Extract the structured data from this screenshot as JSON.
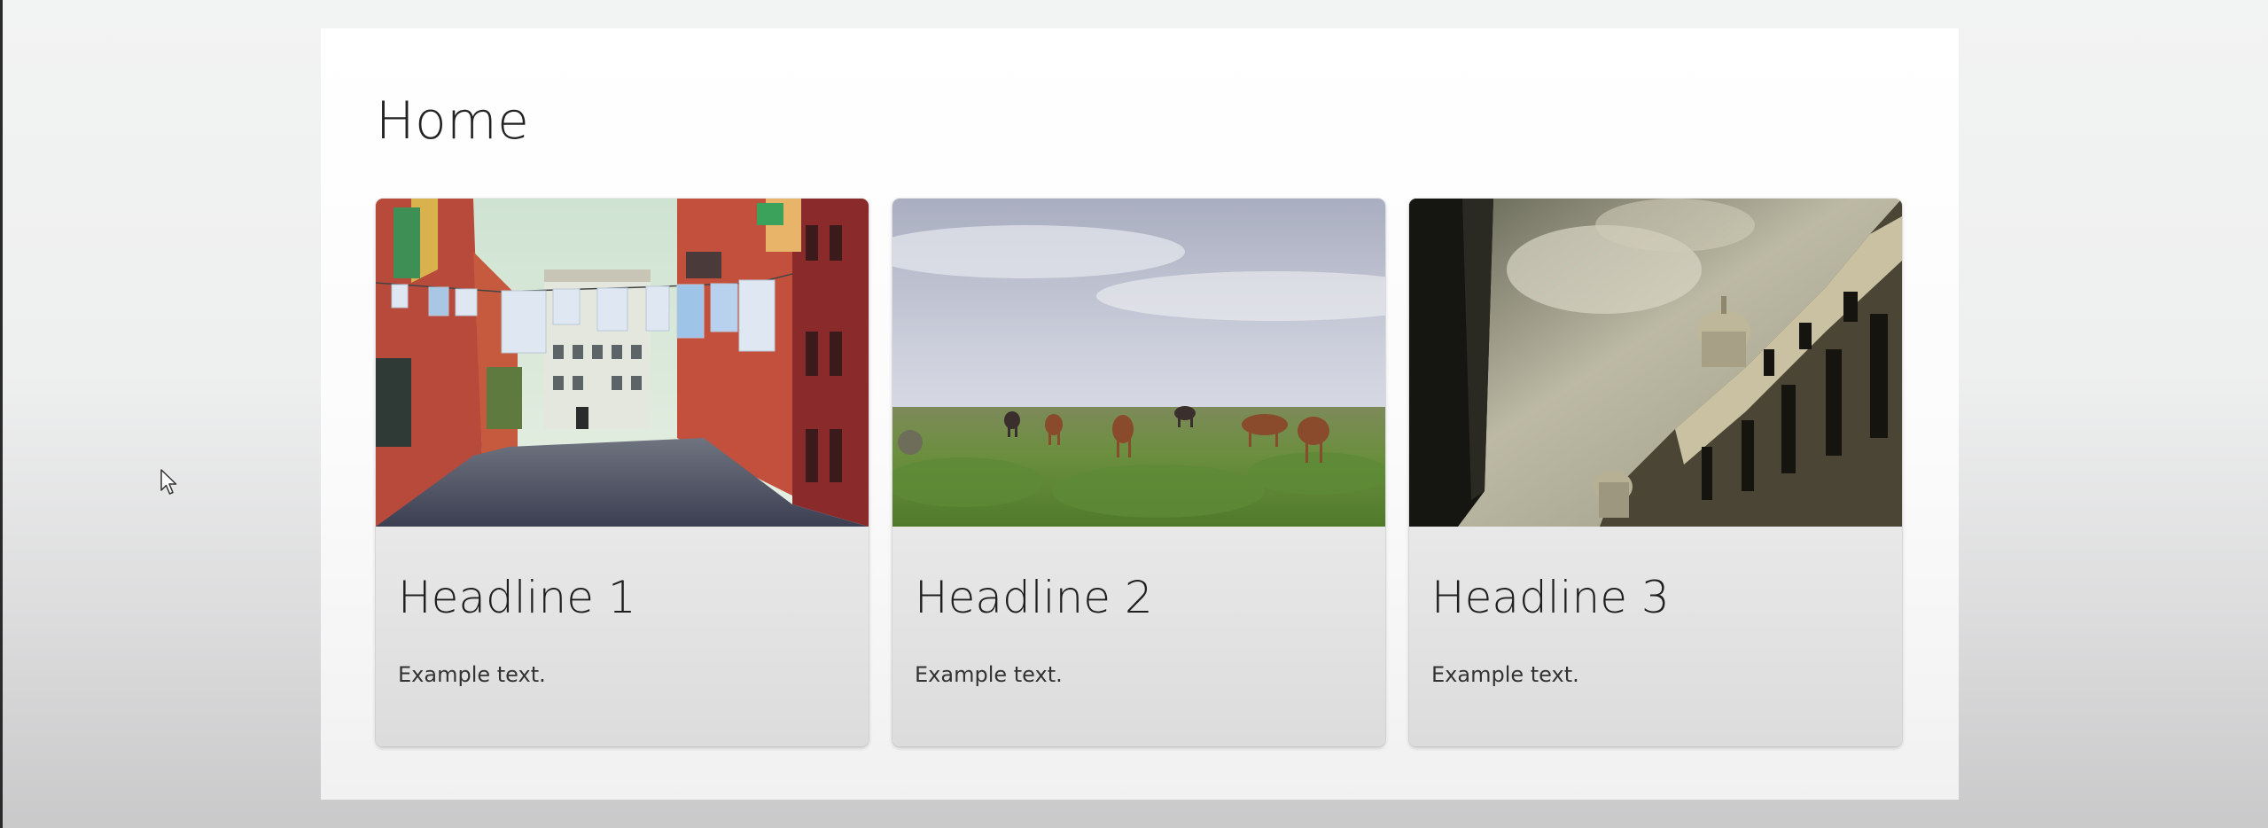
{
  "page": {
    "title": "Home"
  },
  "cards": [
    {
      "headline": "Headline 1",
      "text": "Example text.",
      "image_subject": "narrow street with colorful buildings and hanging laundry"
    },
    {
      "headline": "Headline 2",
      "text": "Example text.",
      "image_subject": "horses grazing on a grassy field under a cloudy sky"
    },
    {
      "headline": "Headline 3",
      "text": "Example text.",
      "image_subject": "classical domed building against a dramatic sky"
    }
  ],
  "colors": {
    "panel": "#ffffff",
    "background": "#eeefef",
    "title_text": "#222222",
    "card_bg": "#ececec"
  }
}
